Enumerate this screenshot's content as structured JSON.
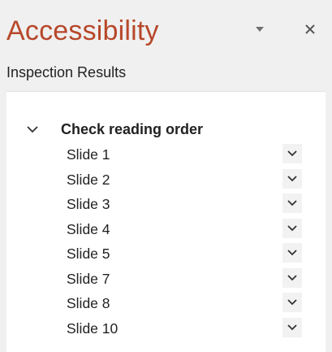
{
  "pane": {
    "title": "Accessibility",
    "options_icon": "caret-down-icon",
    "close_icon": "close-icon"
  },
  "inspection": {
    "label": "Inspection Results",
    "group": {
      "title": "Check reading order",
      "expanded": true,
      "toggle_icon": "chevron-down-icon",
      "items": [
        {
          "label": "Slide 1"
        },
        {
          "label": "Slide 2"
        },
        {
          "label": "Slide 3"
        },
        {
          "label": "Slide 4"
        },
        {
          "label": "Slide 5"
        },
        {
          "label": "Slide 7"
        },
        {
          "label": "Slide 8"
        },
        {
          "label": "Slide 10"
        }
      ],
      "item_expand_icon": "chevron-down-icon"
    }
  },
  "colors": {
    "title": "#b7472a",
    "pane_bg": "#f0f0f0",
    "results_bg": "#ffffff"
  }
}
